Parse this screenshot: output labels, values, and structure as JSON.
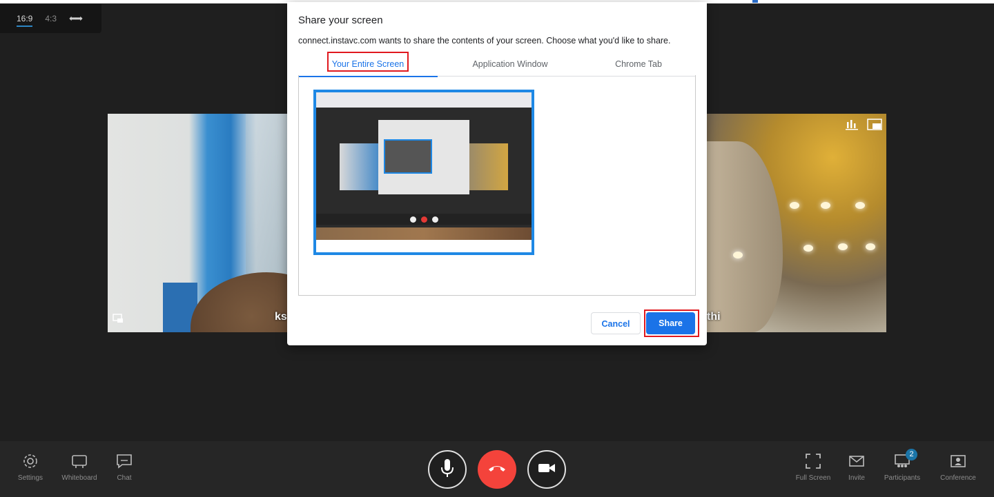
{
  "aspect": {
    "option_169": "16:9",
    "option_43": "4:3",
    "swap_icon": "arrows-swap-icon"
  },
  "tiles": {
    "left_name": "ks",
    "right_name": "thi",
    "right_icons": [
      "stats-icon",
      "pip-icon"
    ]
  },
  "modal": {
    "title": "Share your screen",
    "description": "connect.instavc.com wants to share the contents of your screen. Choose what you'd like to share.",
    "tabs": [
      {
        "label": "Your Entire Screen",
        "selected": true
      },
      {
        "label": "Application Window",
        "selected": false
      },
      {
        "label": "Chrome Tab",
        "selected": false
      }
    ],
    "cancel_label": "Cancel",
    "share_label": "Share",
    "accent_color": "#1a73e8",
    "highlight_color": "#e0181e"
  },
  "toolbar": {
    "left": [
      {
        "label": "Settings",
        "icon": "gear-icon"
      },
      {
        "label": "Whiteboard",
        "icon": "whiteboard-icon"
      },
      {
        "label": "Chat",
        "icon": "chat-icon"
      }
    ],
    "center": {
      "mic_icon": "microphone-icon",
      "end_call_icon": "end-call-icon",
      "camera_icon": "video-camera-icon",
      "end_call_color": "#f4433b"
    },
    "right": [
      {
        "label": "Full Screen",
        "icon": "fullscreen-icon"
      },
      {
        "label": "Invite",
        "icon": "invite-icon"
      },
      {
        "label": "Participants",
        "icon": "participants-icon"
      },
      {
        "label": "Conference",
        "icon": "conference-icon"
      }
    ],
    "participants_count": "2"
  }
}
